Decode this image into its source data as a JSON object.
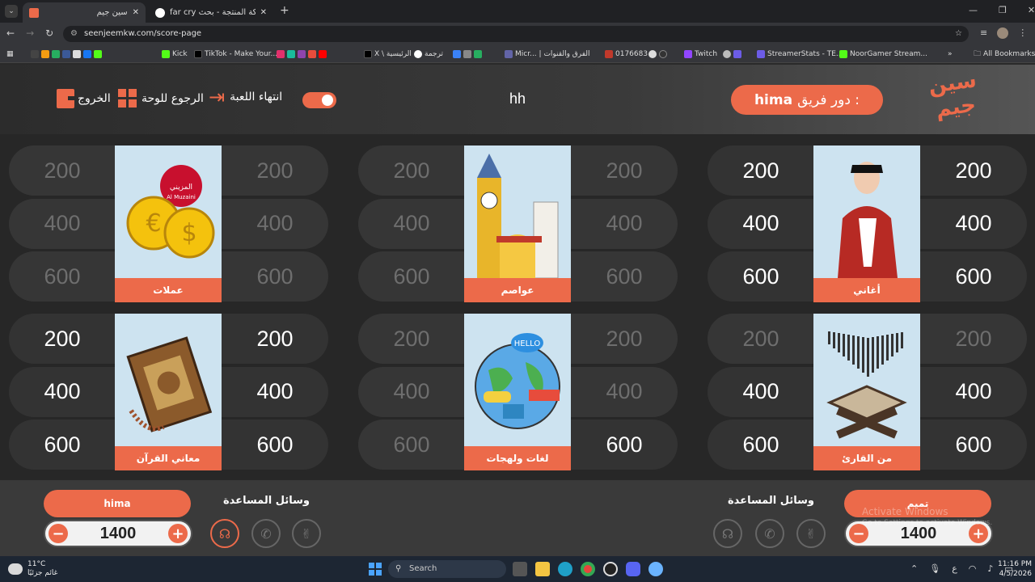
{
  "browser": {
    "tabs": [
      {
        "title": "سين جيم"
      },
      {
        "title": "far cry شركة المنتجة - بحث Goog"
      }
    ],
    "url": "seenjeemkw.com/score-page",
    "bookmarks": [
      "Kick",
      "TikTok - Make Your...",
      "X \\ الرئيسية",
      "ترجمة",
      "Micr... | الفرق والقنوات",
      "0176683",
      "Twitch",
      "StreamerStats - TE...",
      "NoorGamer Stream..."
    ],
    "all_bookmarks": "All Bookmarks"
  },
  "header": {
    "logo_line1": "سين",
    "logo_line2": "جيم",
    "turn_label": "دور فريق :",
    "turn_team": "hima",
    "game_name": "hh",
    "end_game": "انتهاء اللعبة",
    "back_to_board": "الرجوع للوحة",
    "exit": "الخروج"
  },
  "colors": {
    "accent": "#ec6a4a"
  },
  "categories": [
    {
      "name": "أغاني",
      "icon": "singer-icon",
      "left": [
        "200",
        "400",
        "600"
      ],
      "right": [
        "200",
        "400",
        "600"
      ],
      "left_on": [
        true,
        true,
        true
      ],
      "right_on": [
        true,
        true,
        true
      ]
    },
    {
      "name": "عواصم",
      "icon": "landmarks-icon",
      "left": [
        "200",
        "400",
        "600"
      ],
      "right": [
        "200",
        "400",
        "600"
      ],
      "left_on": [
        false,
        false,
        false
      ],
      "right_on": [
        false,
        false,
        false
      ]
    },
    {
      "name": "عملات",
      "icon": "coins-icon",
      "left": [
        "200",
        "400",
        "600"
      ],
      "right": [
        "200",
        "400",
        "600"
      ],
      "left_on": [
        false,
        false,
        false
      ],
      "right_on": [
        false,
        false,
        false
      ]
    },
    {
      "name": "من القارئ",
      "icon": "quran-stand-icon",
      "left": [
        "200",
        "400",
        "600"
      ],
      "right": [
        "200",
        "400",
        "600"
      ],
      "left_on": [
        false,
        true,
        true
      ],
      "right_on": [
        false,
        true,
        true
      ]
    },
    {
      "name": "لغات ولهجات",
      "icon": "globe-languages-icon",
      "left": [
        "200",
        "400",
        "600"
      ],
      "right": [
        "200",
        "400",
        "600"
      ],
      "left_on": [
        false,
        false,
        false
      ],
      "right_on": [
        false,
        false,
        true
      ]
    },
    {
      "name": "معاني القرآن",
      "icon": "quran-book-icon",
      "left": [
        "200",
        "400",
        "600"
      ],
      "right": [
        "200",
        "400",
        "600"
      ],
      "left_on": [
        true,
        true,
        true
      ],
      "right_on": [
        true,
        true,
        true
      ]
    }
  ],
  "coin_brand": "المزيني",
  "coin_brand_en": "Al Muzaini",
  "teams": {
    "right": {
      "name": "تميم",
      "score": "1400",
      "aids_label": "وسائل المساعدة"
    },
    "left": {
      "name": "hima",
      "score": "1400",
      "aids_label": "وسائل المساعدة"
    }
  },
  "watermark": {
    "line1": "Activate Windows",
    "line2": "Go to Settings to activate Windows."
  },
  "taskbar": {
    "weather_temp": "11°C",
    "weather_desc": "غائم جزئيًا",
    "search": "Search",
    "time": "11:16 PM",
    "date": "4/5/2026",
    "lang": "ع"
  }
}
